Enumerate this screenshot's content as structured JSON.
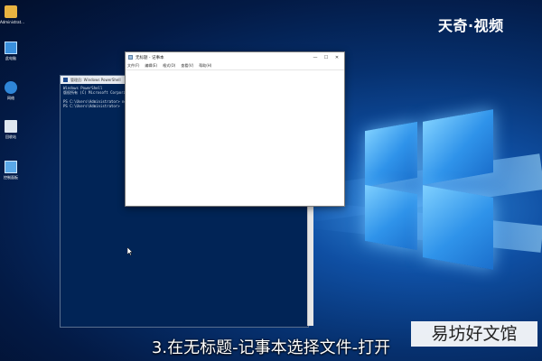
{
  "watermark_top": "天奇·视频",
  "watermark_bottom": "易坊好文馆",
  "subtitle": "3.在无标题-记事本选择文件-打开",
  "desktop_icons": [
    {
      "label": "Administrat...",
      "icon": "user-folder-icon"
    },
    {
      "label": "此电脑",
      "icon": "computer-icon"
    },
    {
      "label": "网络",
      "icon": "network-icon"
    },
    {
      "label": "回收站",
      "icon": "recycle-bin-icon"
    },
    {
      "label": "控制面板",
      "icon": "control-panel-icon"
    }
  ],
  "powershell": {
    "title": "管理员: Windows PowerShell",
    "lines": [
      "Windows PowerShell",
      "版权所有 (C) Microsoft Corporation。保留所有权利。",
      "",
      "PS C:\\Users\\Administrator> notepad",
      "PS C:\\Users\\Administrator>"
    ]
  },
  "notepad": {
    "title": "无标题 - 记事本",
    "menu": [
      "文件(F)",
      "编辑(E)",
      "格式(O)",
      "查看(V)",
      "帮助(H)"
    ],
    "controls": {
      "minimize": "—",
      "maximize": "☐",
      "close": "✕"
    }
  },
  "colors": {
    "desktop_blue": "#06306e",
    "powershell_bg": "#012456"
  }
}
